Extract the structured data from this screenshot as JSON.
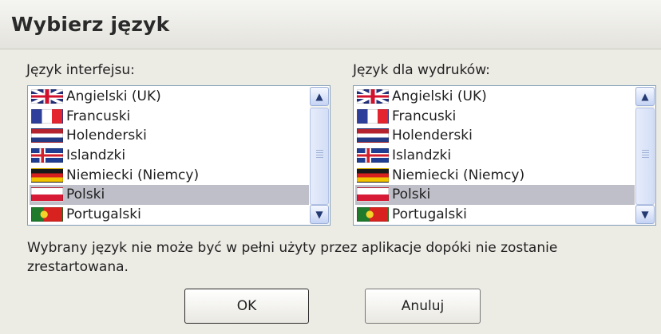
{
  "dialog": {
    "title": "Wybierz język"
  },
  "interface_language": {
    "label": "Język interfejsu:",
    "selected": "Polski",
    "items": [
      {
        "label": "Angielski (UK)",
        "flag": "flag-uk-icon"
      },
      {
        "label": "Francuski",
        "flag": "flag-fr-icon"
      },
      {
        "label": "Holenderski",
        "flag": "flag-nl-icon"
      },
      {
        "label": "Islandzki",
        "flag": "flag-is-icon"
      },
      {
        "label": "Niemiecki (Niemcy)",
        "flag": "flag-de-icon"
      },
      {
        "label": "Polski",
        "flag": "flag-pl-icon"
      },
      {
        "label": "Portugalski",
        "flag": "flag-pt-icon"
      }
    ]
  },
  "print_language": {
    "label": "Język dla wydruków:",
    "selected": "Polski",
    "items": [
      {
        "label": "Angielski (UK)",
        "flag": "flag-uk-icon"
      },
      {
        "label": "Francuski",
        "flag": "flag-fr-icon"
      },
      {
        "label": "Holenderski",
        "flag": "flag-nl-icon"
      },
      {
        "label": "Islandzki",
        "flag": "flag-is-icon"
      },
      {
        "label": "Niemiecki (Niemcy)",
        "flag": "flag-de-icon"
      },
      {
        "label": "Polski",
        "flag": "flag-pl-icon"
      },
      {
        "label": "Portugalski",
        "flag": "flag-pt-icon"
      }
    ]
  },
  "note": "Wybrany język nie może być w pełni użyty przez aplikacje dopóki nie zostanie zrestartowana.",
  "buttons": {
    "ok": "OK",
    "cancel": "Anuluj"
  },
  "colors": {
    "selection": "#bfbfc9",
    "list_border": "#7f9db9",
    "dialog_background": "#ecebe4"
  }
}
